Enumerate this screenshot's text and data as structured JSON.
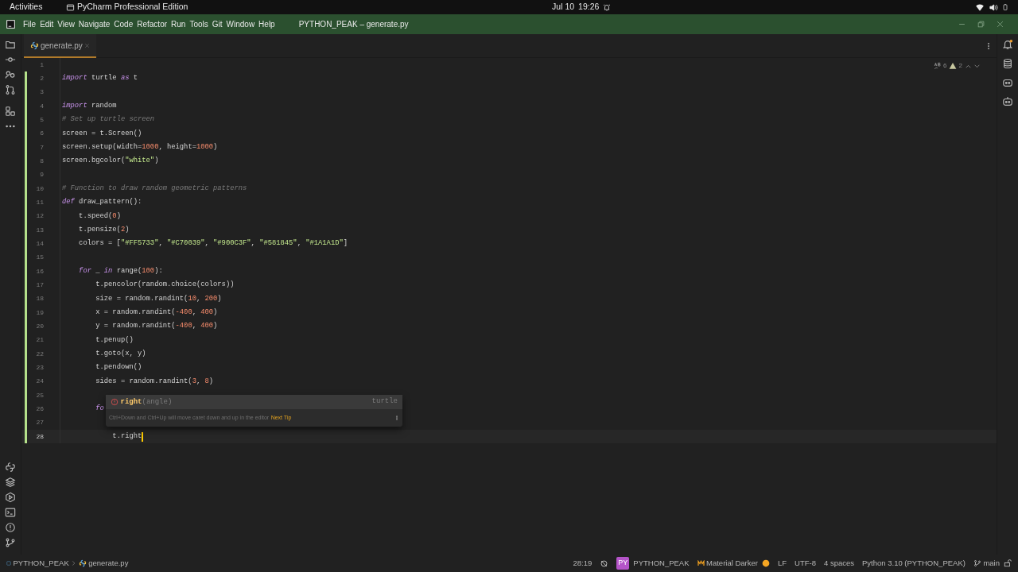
{
  "system_bar": {
    "activities": "Activities",
    "app": "PyCharm Professional Edition",
    "date": "Jul 10",
    "time": "19:26"
  },
  "title_bar": {
    "menus": [
      "File",
      "Edit",
      "View",
      "Navigate",
      "Code",
      "Refactor",
      "Run",
      "Tools",
      "Git",
      "Window",
      "Help"
    ],
    "title": "PYTHON_PEAK – generate.py"
  },
  "tabs": [
    {
      "label": "generate.py",
      "selected": true
    }
  ],
  "inspections": {
    "typos": "6",
    "warnings": "2"
  },
  "editor": {
    "lines": [
      {
        "number": "1",
        "changed": false,
        "current": false
      },
      {
        "number": "2",
        "changed": true,
        "current": false,
        "tokens": [
          {
            "kind": "keyword",
            "text": "import"
          },
          {
            "kind": "plain",
            "text": " turtle "
          },
          {
            "kind": "keyword",
            "text": "as"
          },
          {
            "kind": "plain",
            "text": " t"
          }
        ]
      },
      {
        "number": "3",
        "changed": true,
        "current": false
      },
      {
        "number": "4",
        "changed": true,
        "current": false,
        "tokens": [
          {
            "kind": "keyword",
            "text": "import"
          },
          {
            "kind": "plain",
            "text": " random"
          }
        ]
      },
      {
        "number": "5",
        "changed": true,
        "current": false,
        "tokens": [
          {
            "kind": "comment",
            "text": "# Set up turtle screen"
          }
        ]
      },
      {
        "number": "6",
        "changed": true,
        "current": false,
        "tokens": [
          {
            "kind": "plain",
            "text": "screen = t.Screen()"
          }
        ]
      },
      {
        "number": "7",
        "changed": true,
        "current": false,
        "tokens": [
          {
            "kind": "plain",
            "text": "screen.setup(width="
          },
          {
            "kind": "number",
            "text": "1000"
          },
          {
            "kind": "plain",
            "text": ", height="
          },
          {
            "kind": "number",
            "text": "1000"
          },
          {
            "kind": "plain",
            "text": ")"
          }
        ]
      },
      {
        "number": "8",
        "changed": true,
        "current": false,
        "tokens": [
          {
            "kind": "plain",
            "text": "screen.bgcolor("
          },
          {
            "kind": "string",
            "text": "\"white\""
          },
          {
            "kind": "plain",
            "text": ")"
          }
        ]
      },
      {
        "number": "9",
        "changed": true,
        "current": false
      },
      {
        "number": "10",
        "changed": true,
        "current": false,
        "tokens": [
          {
            "kind": "comment",
            "text": "# Function to draw random geometric patterns"
          }
        ]
      },
      {
        "number": "11",
        "changed": true,
        "current": false,
        "tokens": [
          {
            "kind": "keyword",
            "text": "def"
          },
          {
            "kind": "plain",
            "text": " draw_pattern():"
          }
        ],
        "children": [
          {
            "number": "12",
            "changed": true,
            "current": false,
            "tokens": [
              {
                "kind": "plain",
                "text": "t.speed("
              },
              {
                "kind": "number",
                "text": "0"
              },
              {
                "kind": "plain",
                "text": ")"
              }
            ]
          },
          {
            "number": "13",
            "changed": true,
            "current": false,
            "tokens": [
              {
                "kind": "plain",
                "text": "t.pensize("
              },
              {
                "kind": "number",
                "text": "2"
              },
              {
                "kind": "plain",
                "text": ")"
              }
            ]
          },
          {
            "number": "14",
            "changed": true,
            "current": false,
            "tokens": [
              {
                "kind": "plain",
                "text": "colors = ["
              },
              {
                "kind": "string",
                "text": "\"#FF5733\""
              },
              {
                "kind": "plain",
                "text": ", "
              },
              {
                "kind": "string",
                "text": "\"#C70039\""
              },
              {
                "kind": "plain",
                "text": ", "
              },
              {
                "kind": "string",
                "text": "\"#900C3F\""
              },
              {
                "kind": "plain",
                "text": ", "
              },
              {
                "kind": "string",
                "text": "\"#581845\""
              },
              {
                "kind": "plain",
                "text": ", "
              },
              {
                "kind": "string",
                "text": "\"#1A1A1D\""
              },
              {
                "kind": "plain",
                "text": "]"
              }
            ]
          },
          {
            "number": "15",
            "changed": true,
            "current": false
          },
          {
            "number": "16",
            "changed": true,
            "current": false,
            "tokens": [
              {
                "kind": "keyword",
                "text": "for"
              },
              {
                "kind": "plain",
                "text": " _ "
              },
              {
                "kind": "keyword",
                "text": "in"
              },
              {
                "kind": "plain",
                "text": " range("
              },
              {
                "kind": "number",
                "text": "100"
              },
              {
                "kind": "plain",
                "text": "):"
              }
            ],
            "children": [
              {
                "number": "17",
                "changed": true,
                "current": false,
                "tokens": [
                  {
                    "kind": "plain",
                    "text": "t.pencolor(random.choice(colors))"
                  }
                ]
              },
              {
                "number": "18",
                "changed": true,
                "current": false,
                "tokens": [
                  {
                    "kind": "plain",
                    "text": "size = random.randint("
                  },
                  {
                    "kind": "number",
                    "text": "10"
                  },
                  {
                    "kind": "plain",
                    "text": ", "
                  },
                  {
                    "kind": "number",
                    "text": "200"
                  },
                  {
                    "kind": "plain",
                    "text": ")"
                  }
                ]
              },
              {
                "number": "19",
                "changed": true,
                "current": false,
                "tokens": [
                  {
                    "kind": "plain",
                    "text": "x = random.randint("
                  },
                  {
                    "kind": "number",
                    "text": "-400"
                  },
                  {
                    "kind": "plain",
                    "text": ", "
                  },
                  {
                    "kind": "number",
                    "text": "400"
                  },
                  {
                    "kind": "plain",
                    "text": ")"
                  }
                ]
              },
              {
                "number": "20",
                "changed": true,
                "current": false,
                "tokens": [
                  {
                    "kind": "plain",
                    "text": "y = random.randint("
                  },
                  {
                    "kind": "number",
                    "text": "-400"
                  },
                  {
                    "kind": "plain",
                    "text": ", "
                  },
                  {
                    "kind": "number",
                    "text": "400"
                  },
                  {
                    "kind": "plain",
                    "text": ")"
                  }
                ]
              },
              {
                "number": "21",
                "changed": true,
                "current": false,
                "tokens": [
                  {
                    "kind": "plain",
                    "text": "t.penup()"
                  }
                ]
              },
              {
                "number": "22",
                "changed": true,
                "current": false,
                "tokens": [
                  {
                    "kind": "plain",
                    "text": "t.goto(x, y)"
                  }
                ]
              },
              {
                "number": "23",
                "changed": true,
                "current": false,
                "tokens": [
                  {
                    "kind": "plain",
                    "text": "t.pendown()"
                  }
                ]
              },
              {
                "number": "24",
                "changed": true,
                "current": false,
                "tokens": [
                  {
                    "kind": "plain",
                    "text": "sides = random.randint("
                  },
                  {
                    "kind": "number",
                    "text": "3"
                  },
                  {
                    "kind": "plain",
                    "text": ", "
                  },
                  {
                    "kind": "number",
                    "text": "8"
                  },
                  {
                    "kind": "plain",
                    "text": ")"
                  }
                ]
              },
              {
                "number": "25",
                "changed": true,
                "current": false
              },
              {
                "number": "26",
                "changed": true,
                "current": false,
                "tokens": [
                  {
                    "kind": "keyword",
                    "text": "fo"
                  }
                ],
                "children": [
                  {
                    "number": "27",
                    "changed": true,
                    "current": false
                  },
                  {
                    "number": "28",
                    "changed": true,
                    "current": true,
                    "tokens": [
                      {
                        "kind": "plain",
                        "text": "t.right"
                      }
                    ]
                  }
                ]
              }
            ]
          }
        ]
      }
    ]
  },
  "completion": {
    "name": "right",
    "params": "(angle)",
    "module": "turtle",
    "tip": "Ctrl+Down and Ctrl+Up will move caret down and up in the editor",
    "tip_link": "Next Tip"
  },
  "status_bar": {
    "breadcrumbs": [
      "PYTHON_PEAK",
      "generate.py"
    ],
    "position": "28:19",
    "project_badge": "PY",
    "project": "PYTHON_PEAK",
    "theme": "Material Darker",
    "line_ending": "LF",
    "encoding": "UTF-8",
    "indent": "4 spaces",
    "interpreter": "Python 3.10 (PYTHON_PEAK)",
    "branch": "main"
  }
}
